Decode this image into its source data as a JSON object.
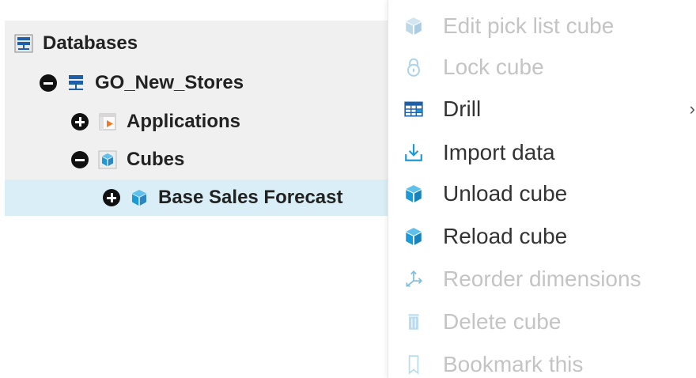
{
  "tree": {
    "items": [
      {
        "label": "Databases",
        "icon": "database-server-icon",
        "expanded": true
      },
      {
        "label": "GO_New_Stores",
        "icon": "database-icon",
        "expanded": true
      },
      {
        "label": "Applications",
        "icon": "applications-icon",
        "expanded": false
      },
      {
        "label": "Cubes",
        "icon": "cubes-folder-icon",
        "expanded": true
      },
      {
        "label": "Base Sales Forecast",
        "icon": "cube-icon",
        "expanded": false,
        "selected": true
      }
    ]
  },
  "context_menu": {
    "items": [
      {
        "label": "Edit pick list cube",
        "icon": "cube-icon",
        "enabled": false
      },
      {
        "label": "Lock cube",
        "icon": "lock-icon",
        "enabled": false
      },
      {
        "label": "Drill",
        "icon": "drill-grid-icon",
        "enabled": true,
        "submenu": true,
        "submenu_arrow": "›"
      },
      {
        "label": "Import data",
        "icon": "import-icon",
        "enabled": true
      },
      {
        "label": "Unload cube",
        "icon": "cube-icon",
        "enabled": true
      },
      {
        "label": "Reload cube",
        "icon": "cube-icon",
        "enabled": true
      },
      {
        "label": "Reorder dimensions",
        "icon": "reorder-dimensions-icon",
        "enabled": false
      },
      {
        "label": "Delete cube",
        "icon": "trash-icon",
        "enabled": false
      },
      {
        "label": "Bookmark this",
        "icon": "bookmark-icon",
        "enabled": false
      }
    ]
  },
  "colors": {
    "accent_blue": "#1a9ad6",
    "selected_row": "#d9eef7",
    "disabled_text": "#c4c4c4",
    "tree_background": "#f0f0f0"
  }
}
